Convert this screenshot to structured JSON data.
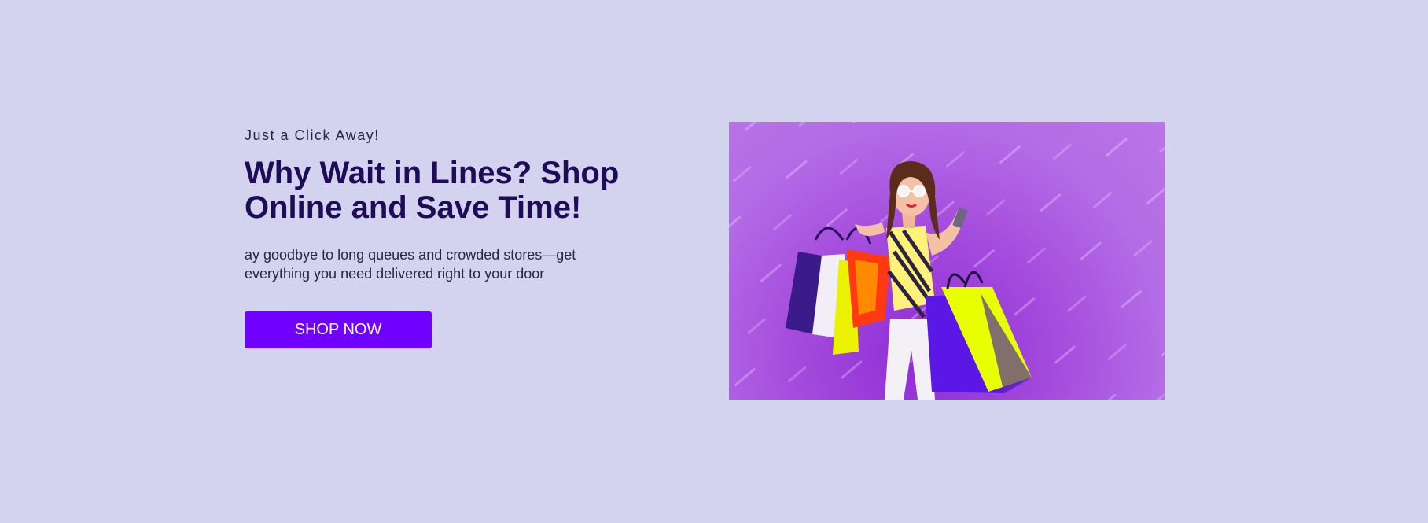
{
  "hero": {
    "eyebrow": "Just a Click Away!",
    "headline": "Why Wait in Lines? Shop Online and Save Time!",
    "subtext": "ay goodbye to long queues and crowded stores—get everything you need delivered right to your door",
    "cta_label": "SHOP NOW",
    "image": {
      "subject": "woman-with-shopping-bags-and-phone",
      "watermark_icon": "watermark-pattern"
    }
  },
  "colors": {
    "background": "#d4d3ef",
    "headline": "#1f0c57",
    "body_text": "#2a2440",
    "accent": "#7000ff",
    "image_background": "#b46be6",
    "bag_yellow": "#e8ff00",
    "bag_purple": "#5a17e6"
  }
}
